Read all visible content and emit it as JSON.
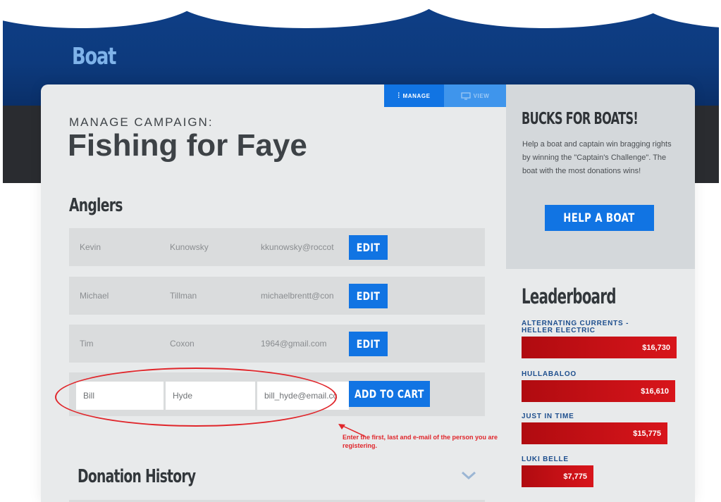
{
  "site": {
    "title": "Boat"
  },
  "modes": {
    "manage_label": "MANAGE",
    "view_label": "VIEW"
  },
  "campaign": {
    "label": "MANAGE CAMPAIGN:",
    "name": "Fishing for Faye"
  },
  "anglers": {
    "title": "Anglers",
    "rows": [
      {
        "first": "Kevin",
        "last": "Kunowsky",
        "email": "kkunowsky@roccot",
        "action": "EDIT"
      },
      {
        "first": "Michael",
        "last": "Tillman",
        "email": "michaelbrentt@con",
        "action": "EDIT"
      },
      {
        "first": "Tim",
        "last": "Coxon",
        "email": "1964@gmail.com",
        "action": "EDIT"
      }
    ],
    "new_entry": {
      "first_value": "Bill",
      "last_value": "Hyde",
      "email_value": "bill_hyde@email.cc",
      "add_label": "ADD TO CART"
    }
  },
  "annotation": {
    "text": "Enter the first, last and e-mail of the person you are registering."
  },
  "donation_history": {
    "title": "Donation History"
  },
  "sidebar": {
    "bucks": {
      "title": "BUCKS FOR BOATS!",
      "description": "Help a boat and captain win bragging rights by winning the \"Captain's Challenge\". The boat with the most donations wins!",
      "button_label": "HELP A BOAT"
    },
    "leaderboard": {
      "title": "Leaderboard",
      "entries": [
        {
          "name": "ALTERNATING CURRENTS -\nHELLER ELECTRIC",
          "amount": "$16,730",
          "value": 16730
        },
        {
          "name": "HULLABALOO",
          "amount": "$16,610",
          "value": 16610
        },
        {
          "name": "JUST IN TIME",
          "amount": "$15,775",
          "value": 15775
        },
        {
          "name": "LUKI BELLE",
          "amount": "$7,775",
          "value": 7775
        }
      ]
    }
  },
  "colors": {
    "brand_blue": "#1174e3",
    "header_blue": "#0e3f87",
    "leader_red": "#d8151b",
    "annotation_red": "#e0262b"
  }
}
